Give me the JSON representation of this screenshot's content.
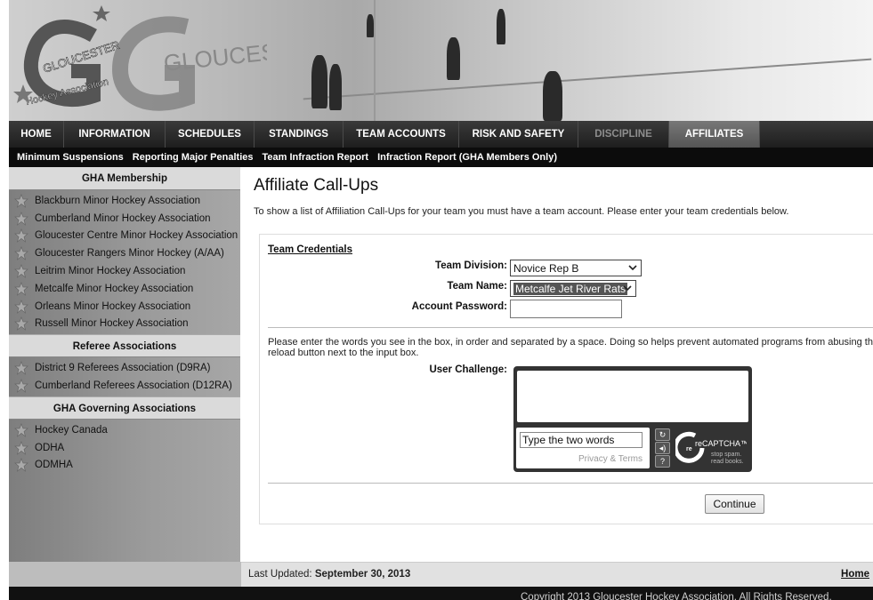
{
  "logo": {
    "line1": "GLOUCESTER",
    "line2": "Hockey Association",
    "big_text": "GLOUCESTER"
  },
  "mainnav": [
    {
      "label": "HOME"
    },
    {
      "label": "INFORMATION"
    },
    {
      "label": "SCHEDULES"
    },
    {
      "label": "STANDINGS"
    },
    {
      "label": "TEAM ACCOUNTS"
    },
    {
      "label": "RISK AND SAFETY"
    },
    {
      "label": "DISCIPLINE"
    },
    {
      "label": "AFFILIATES"
    }
  ],
  "subnav": [
    {
      "label": "Minimum Suspensions"
    },
    {
      "label": "Reporting Major Penalties"
    },
    {
      "label": "Team Infraction Report"
    },
    {
      "label": "Infraction Report (GHA Members Only)"
    }
  ],
  "sidebar": {
    "sections": [
      {
        "title": "GHA Membership",
        "items": [
          "Blackburn Minor Hockey Association",
          "Cumberland Minor Hockey Association",
          "Gloucester Centre Minor Hockey Association",
          "Gloucester Rangers Minor Hockey (A/AA)",
          "Leitrim Minor Hockey Association",
          "Metcalfe Minor Hockey Association",
          "Orleans Minor Hockey Association",
          "Russell Minor Hockey Association"
        ]
      },
      {
        "title": "Referee Associations",
        "items": [
          "District 9 Referees Association (D9RA)",
          "Cumberland Referees Association (D12RA)"
        ]
      },
      {
        "title": "GHA Governing Associations",
        "items": [
          "Hockey Canada",
          "ODHA",
          "ODMHA"
        ]
      }
    ]
  },
  "main": {
    "title": "Affiliate Call-Ups",
    "intro": "To show a list of Affiliation Call-Ups for your team you must have a team account. Please enter your team credentials below.",
    "credentials_label": "Team Credentials",
    "division_label": "Team Division:",
    "division_value": "Novice Rep B",
    "team_label": "Team Name:",
    "team_value": "Metcalfe Jet River Rats",
    "password_label": "Account Password:",
    "challenge_text_1": "Please enter the words you see in the box, in order and separated by a space. Doing so helps prevent automated programs from abusing this service",
    "challenge_text_2": "reload button next to the input box.",
    "challenge_label": "User Challenge:",
    "captcha_placeholder": "Type the two words",
    "captcha_privacy": "Privacy & Terms",
    "captcha_brand": "reCAPTCHA™",
    "captcha_tag1": "stop spam.",
    "captcha_tag2": "read books.",
    "continue_label": "Continue"
  },
  "footer": {
    "last_updated_label": "Last Updated:",
    "last_updated_date": "September 30, 2013",
    "home_link": "Home",
    "copyright": "Copyright 2013 Gloucester Hockey Association. All Rights Reserved."
  }
}
